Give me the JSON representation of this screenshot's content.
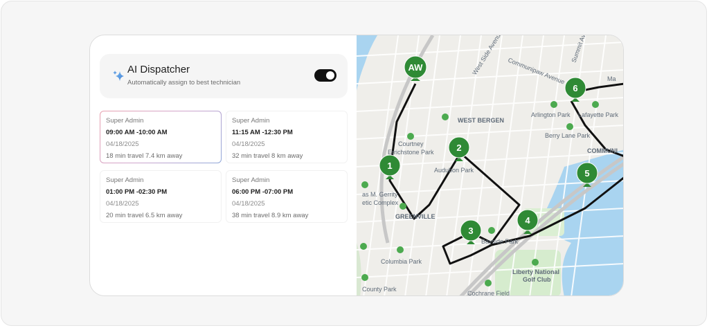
{
  "dispatcher": {
    "title": "AI Dispatcher",
    "subtitle": "Automatically assign to best technician",
    "enabled": true
  },
  "slots": [
    {
      "technician": "Super Admin",
      "time": "09:00 AM -10:00 AM",
      "date": "04/18/2025",
      "travel": "18 min travel 7.4 km away",
      "selected": true
    },
    {
      "technician": "Super Admin",
      "time": "11:15 AM -12:30 PM",
      "date": "04/18/2025",
      "travel": "32 min travel 8 km away",
      "selected": false
    },
    {
      "technician": "Super Admin",
      "time": "01:00 PM -02:30 PM",
      "date": "04/18/2025",
      "travel": "20 min travel 6.5 km away",
      "selected": false
    },
    {
      "technician": "Super Admin",
      "time": "06:00 PM -07:00 PM",
      "date": "04/18/2025",
      "travel": "38 min travel 8.9 km away",
      "selected": false
    }
  ],
  "map": {
    "markers": [
      "AW",
      "1",
      "2",
      "3",
      "4",
      "5",
      "6"
    ],
    "places": [
      "West Side Avenue",
      "Communipaw Avenue",
      "Summit Avenue",
      "WEST BERGEN",
      "Courtney",
      "Errichstone Park",
      "Audubon Park",
      "Arlington Park",
      "Lafayette Park",
      "Berry Lane Park",
      "COMMUNI",
      "Ma",
      "as M. Gerrity",
      "etic Complex",
      "GREENVILLE",
      "Bayside Park",
      "Columbia Park",
      "Liberty National",
      "Golf Club",
      "County Park",
      "Cochrane Field"
    ],
    "colors": {
      "marker": "#2f8a35",
      "route": "#111111",
      "water": "#a9d4f0",
      "land": "#efeeea",
      "park": "#cfe9c7"
    }
  }
}
